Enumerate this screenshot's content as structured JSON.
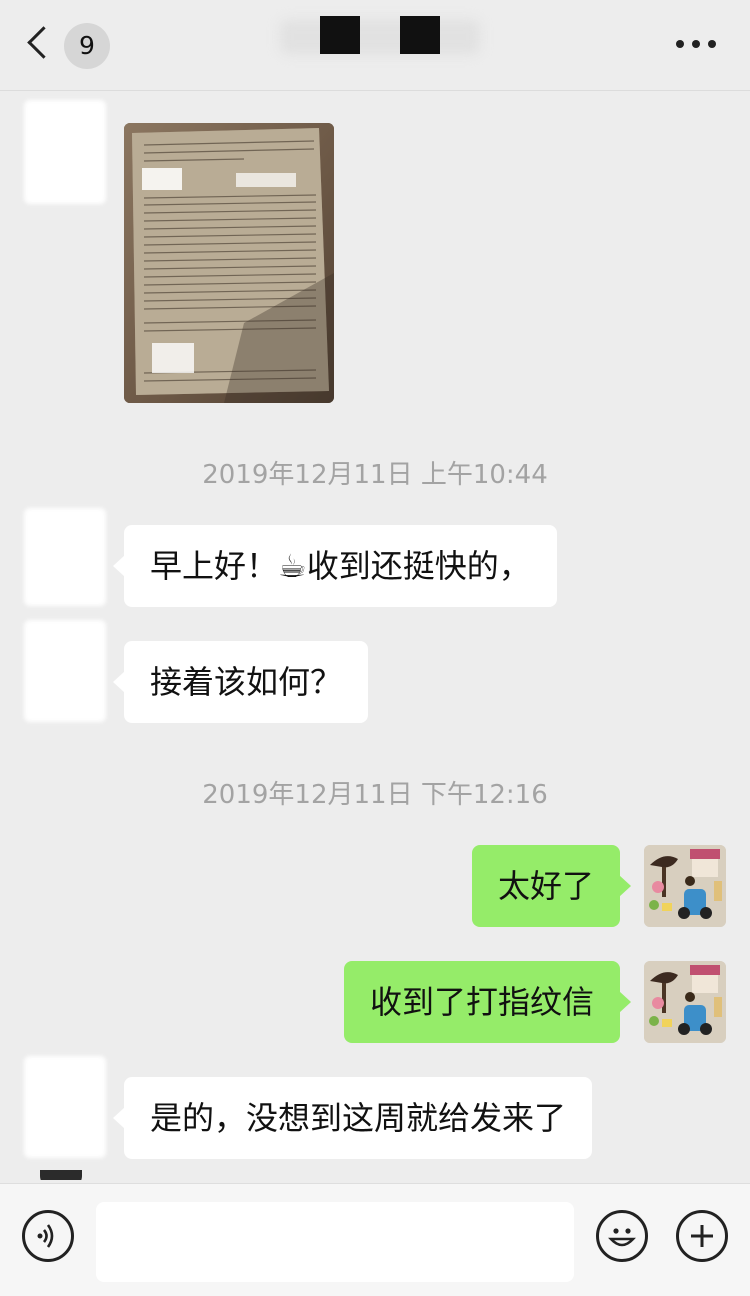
{
  "header": {
    "unread_count": "9",
    "icons": {
      "back": "chevron-left-icon",
      "more": "more-dots-icon"
    }
  },
  "messages": [
    {
      "type": "image",
      "side": "left",
      "description": "photo-of-document"
    },
    {
      "type": "timestamp",
      "text": "2019年12月11日 上午10:44"
    },
    {
      "type": "text",
      "side": "left",
      "text": "早上好！☕收到还挺快的，"
    },
    {
      "type": "text",
      "side": "left",
      "text": "接着该如何？"
    },
    {
      "type": "timestamp",
      "text": "2019年12月11日 下午12:16"
    },
    {
      "type": "text",
      "side": "right",
      "text": "太好了"
    },
    {
      "type": "text",
      "side": "right",
      "text": "收到了打指纹信"
    },
    {
      "type": "text",
      "side": "left",
      "text": "是的，没想到这周就给发来了"
    }
  ],
  "input_bar": {
    "value": "",
    "icons": {
      "voice": "voice-icon",
      "emoji": "emoji-icon",
      "add": "plus-icon"
    }
  },
  "colors": {
    "background": "#ededed",
    "bubble_left": "#ffffff",
    "bubble_right": "#95ec69",
    "timestamp": "#a3a3a3"
  }
}
